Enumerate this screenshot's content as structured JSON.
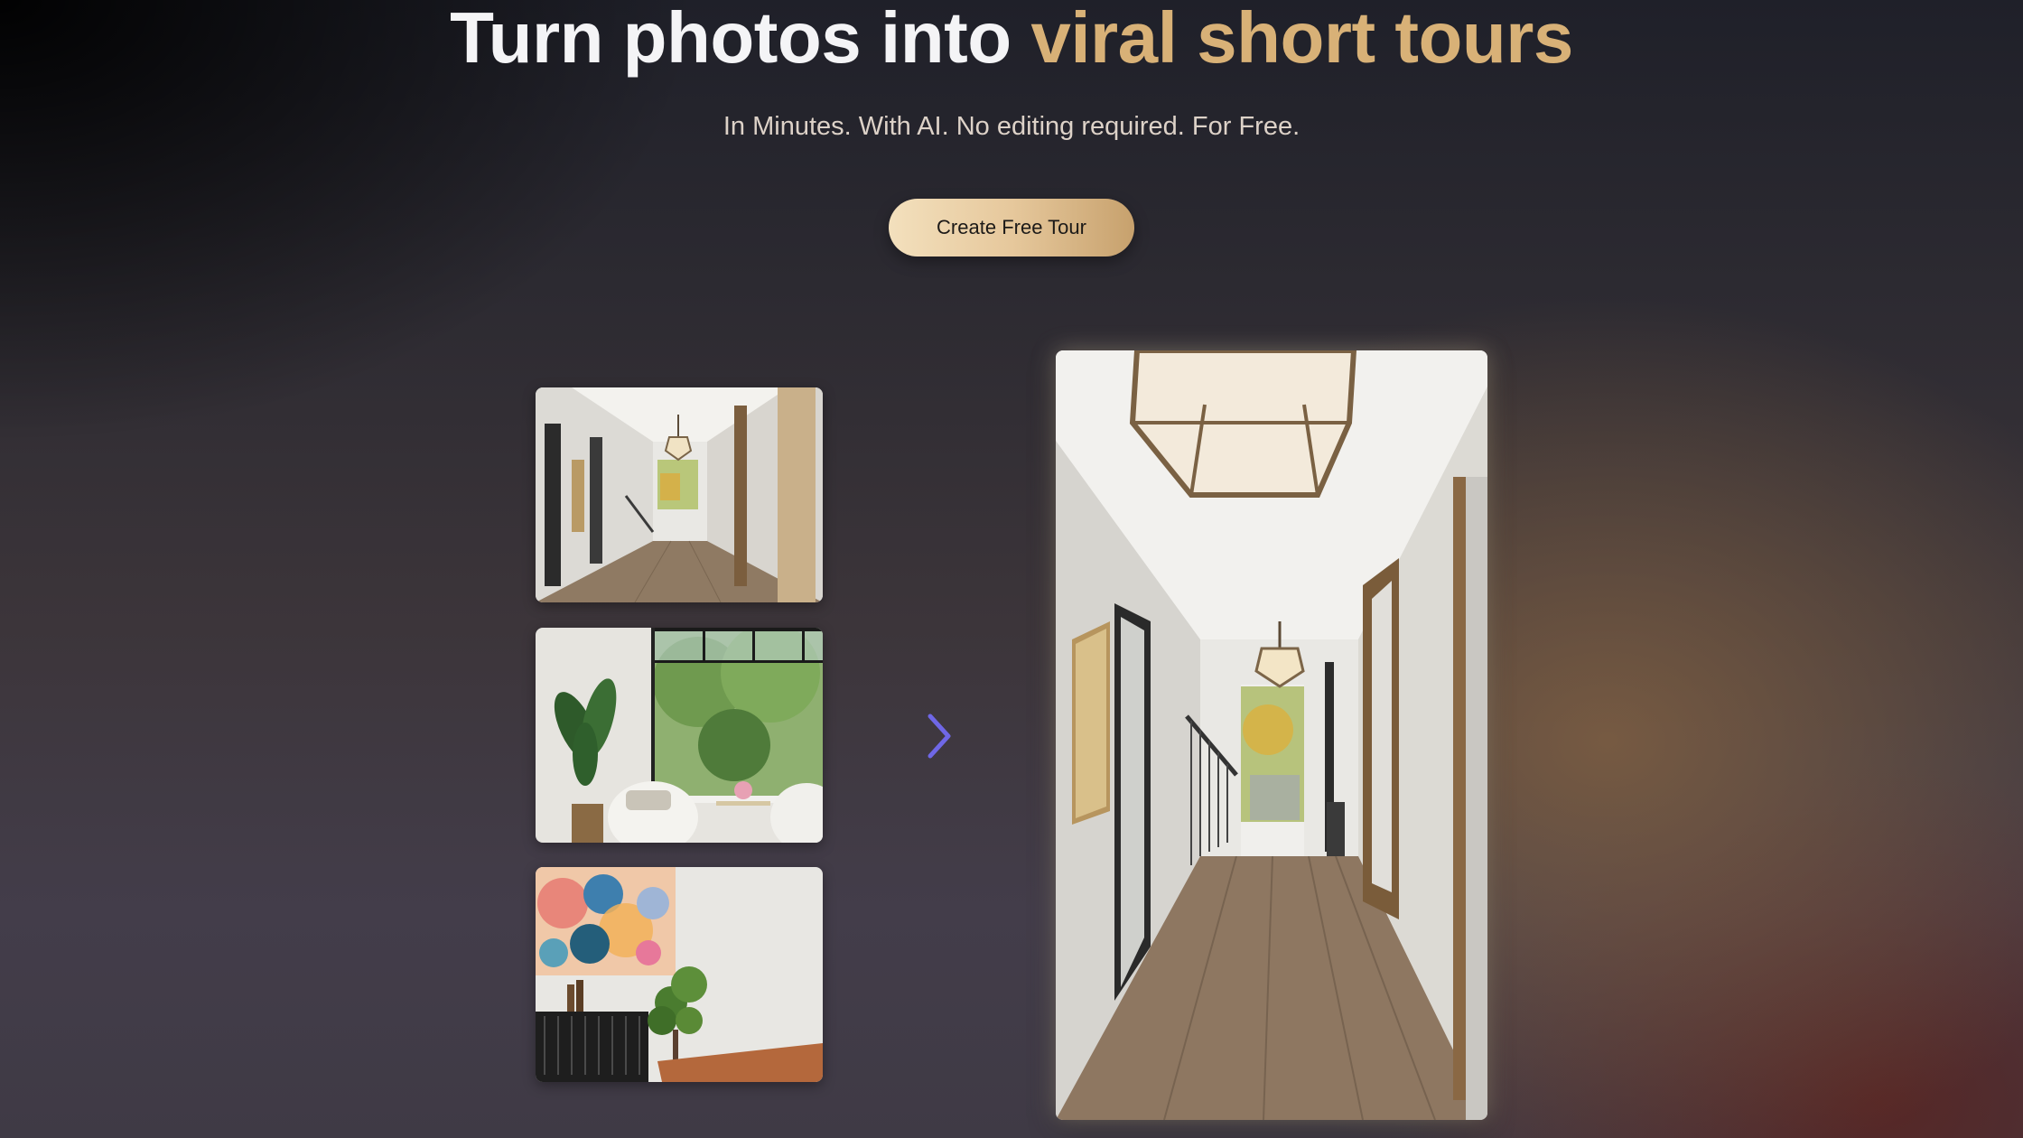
{
  "hero": {
    "title_main": "Turn photos into ",
    "title_accent": "viral short tours",
    "subtitle": "In Minutes. With AI. No editing required. For Free.",
    "cta_label": "Create Free Tour"
  },
  "gallery": {
    "thumbnails": [
      {
        "name": "hallway photo"
      },
      {
        "name": "living room window photo"
      },
      {
        "name": "dining area art photo"
      }
    ],
    "next_icon": "chevron-right-icon"
  },
  "preview": {
    "name": "vertical tour video preview"
  },
  "colors": {
    "accent": "#d8b177",
    "arrow": "#6f67e6",
    "cta_gradient_start": "#f3e0bd",
    "cta_gradient_end": "#c7a16d"
  }
}
